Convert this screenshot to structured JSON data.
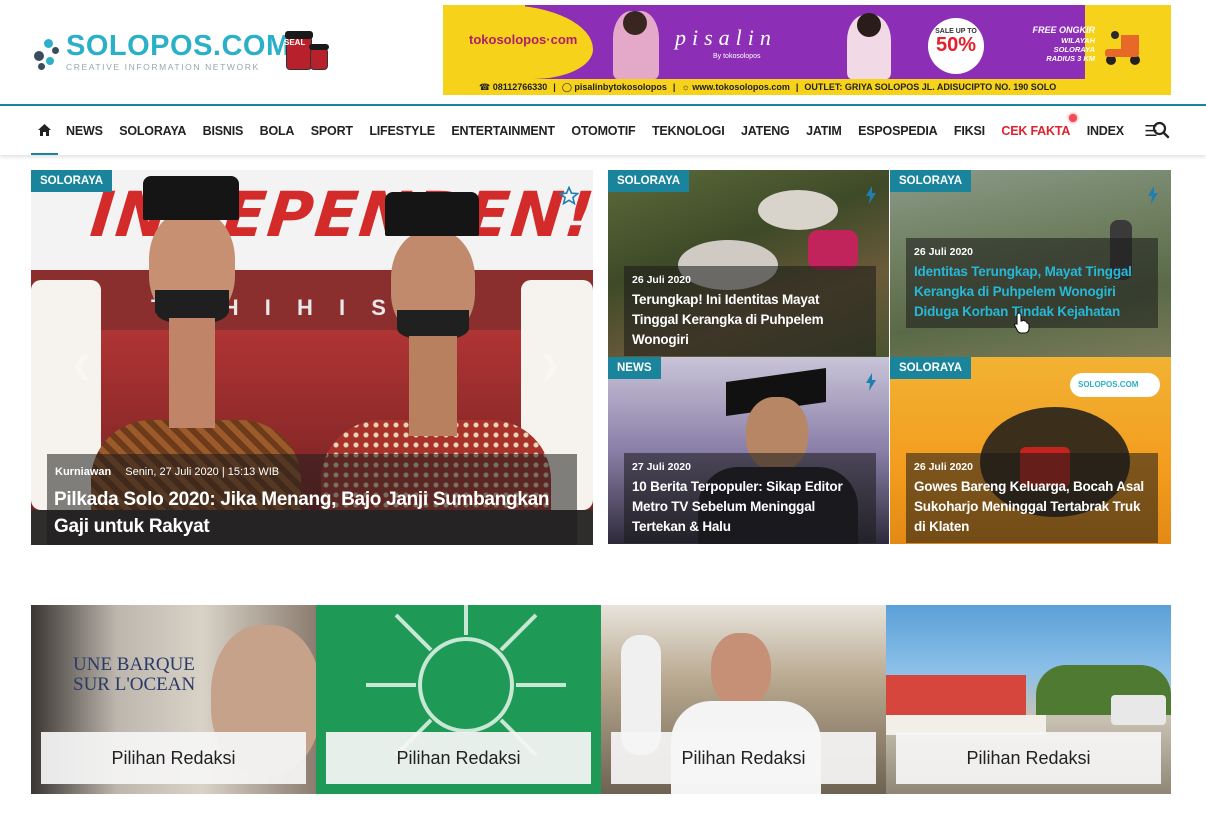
{
  "header": {
    "logo_name": "SOLOPOS.COM",
    "logo_tagline": "CREATIVE INFORMATION NETWORK",
    "seal_label": "SEAL",
    "ad": {
      "brand": "tokosolopos·com",
      "product": "pisalin",
      "product_by": "By tokosolopos",
      "sale_small": "SALE UP TO",
      "sale_big": "50%",
      "ongkir_head": "FREE ONGKIR",
      "ongkir_line1": "WILAYAH SOLORAYA",
      "ongkir_line2": "RADIUS 3 KM",
      "phone": "08112766330",
      "instagram": "pisalinbytokosolopos",
      "website": "www.tokosolopos.com",
      "outlet": "OUTLET: GRIYA SOLOPOS JL. ADISUCIPTO NO. 190 SOLO",
      "colors": {
        "purple": "#8d2fb6",
        "yellow": "#f7d21a"
      }
    }
  },
  "nav": {
    "items": [
      {
        "label": "NEWS"
      },
      {
        "label": "SOLORAYA"
      },
      {
        "label": "BISNIS"
      },
      {
        "label": "BOLA"
      },
      {
        "label": "SPORT"
      },
      {
        "label": "LIFESTYLE"
      },
      {
        "label": "ENTERTAINMENT"
      },
      {
        "label": "OTOMOTIF"
      },
      {
        "label": "TEKNOLOGI"
      },
      {
        "label": "JATENG"
      },
      {
        "label": "JATIM"
      },
      {
        "label": "ESPOSPEDIA"
      },
      {
        "label": "FIKSI"
      },
      {
        "label": "CEK FAKTA"
      },
      {
        "label": "INDEX"
      }
    ],
    "accent": "#19849c",
    "highlight": "#e0222e"
  },
  "hero": {
    "category": "SOLORAYA",
    "author": "Kurniawan",
    "date": "Senin, 27 Juli 2020 | 15:13 WIB",
    "title": "Pilkada Solo 2020: Jika Menang, Bajo Janji Sumbangkan Gaji untuk Rakyat",
    "backdrop_text": "INDEPENDEN!",
    "backdrop_sub": "T I H I  H   I S"
  },
  "cards": [
    {
      "category": "SOLORAYA",
      "date": "26 Juli 2020",
      "title": "Terungkap! Ini Identitas Mayat Tinggal Kerangka di Puhpelem Wonogiri"
    },
    {
      "category": "SOLORAYA",
      "date": "26 Juli 2020",
      "title": "Identitas Terungkap, Mayat Tinggal Kerangka di Puhpelem Wonogiri Diduga Korban Tindak Kejahatan"
    },
    {
      "category": "NEWS",
      "date": "27 Juli 2020",
      "title": "10 Berita Terpopuler: Sikap Editor Metro TV Sebelum Meninggal Tertekan & Halu"
    },
    {
      "category": "SOLORAYA",
      "date": "26 Juli 2020",
      "title": "Gowes Bareng Keluarga, Bocah Asal Sukoharjo Meninggal Tertabrak Truk di Klaten"
    }
  ],
  "card4_logo": "SOLOPOS.COM",
  "picks": [
    {
      "label": "Pilihan Redaksi",
      "poster_title": "UNE BARQUE SUR L'OCEAN"
    },
    {
      "label": "Pilihan Redaksi"
    },
    {
      "label": "Pilihan Redaksi"
    },
    {
      "label": "Pilihan Redaksi"
    }
  ]
}
